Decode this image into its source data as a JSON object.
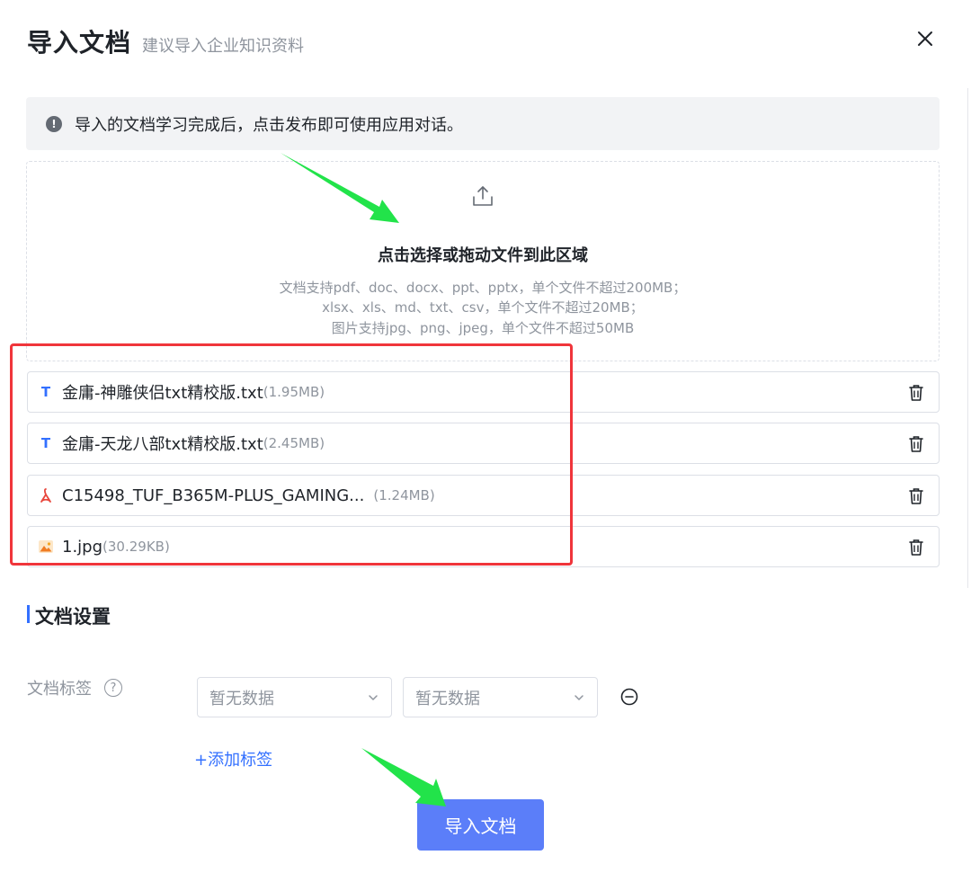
{
  "dialog": {
    "title": "导入文档",
    "subtitle": "建议导入企业知识资料",
    "close_icon": "close-icon"
  },
  "notice": {
    "icon": "info-icon",
    "icon_glyph": "!",
    "text": "导入的文档学习完成后，点击发布即可使用应用对话。"
  },
  "dropzone": {
    "icon": "upload-icon",
    "title": "点击选择或拖动文件到此区域",
    "hints": [
      "文档支持pdf、doc、docx、ppt、pptx，单个文件不超过200MB；",
      "xlsx、xls、md、txt、csv，单个文件不超过20MB；",
      "图片支持jpg、png、jpeg，单个文件不超过50MB"
    ]
  },
  "files": [
    {
      "name": "金庸-神雕侠侣txt精校版.txt",
      "size": "(1.95MB)",
      "type": "txt",
      "icon": "text-file-icon",
      "icon_glyph": "T"
    },
    {
      "name": "金庸-天龙八部txt精校版.txt",
      "size": "(2.45MB)",
      "type": "txt",
      "icon": "text-file-icon",
      "icon_glyph": "T"
    },
    {
      "name": "C15498_TUF_B365M-PLUS_GAMING...",
      "size": "(1.24MB)",
      "type": "pdf",
      "icon": "pdf-file-icon"
    },
    {
      "name": "1.jpg",
      "size": "(30.29KB)",
      "type": "image",
      "icon": "image-file-icon"
    }
  ],
  "settings": {
    "section_title": "文档设置",
    "tag_label": "文档标签",
    "help_glyph": "?",
    "selects": [
      {
        "placeholder": "暂无数据"
      },
      {
        "placeholder": "暂无数据"
      }
    ],
    "add_tag_label": "+添加标签"
  },
  "actions": {
    "submit_label": "导入文档"
  },
  "colors": {
    "primary": "#3370ff",
    "button": "#5b7ef9",
    "highlight_border": "#f0353b",
    "arrow_green": "#22e34a",
    "text_secondary": "#8f959e"
  }
}
